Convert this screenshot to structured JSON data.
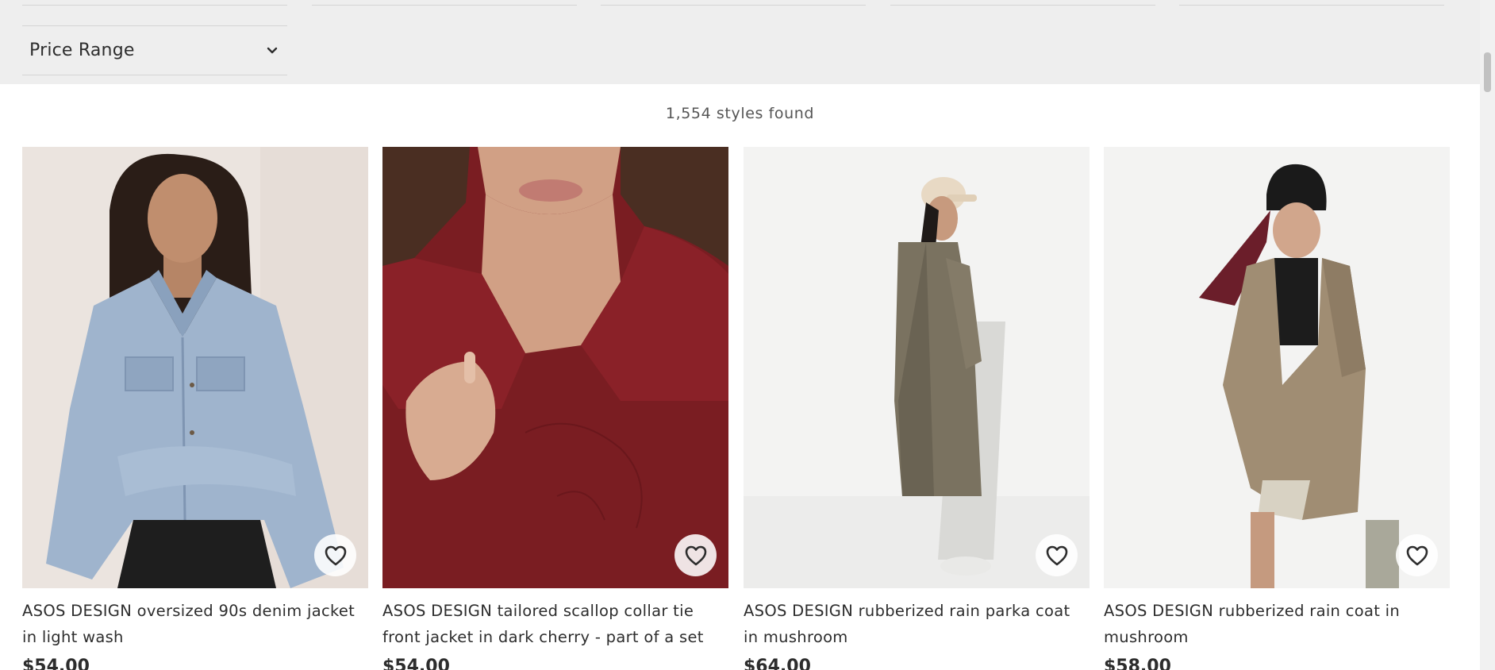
{
  "filters": {
    "price_range_label": "Price Range"
  },
  "results": {
    "count_text": "1,554 styles found"
  },
  "products": [
    {
      "title": "ASOS DESIGN oversized 90s denim jacket in light wash",
      "price": "$54.00"
    },
    {
      "title": "ASOS DESIGN tailored scallop collar tie front jacket in dark cherry - part of a set",
      "price": "$54.00"
    },
    {
      "title": "ASOS DESIGN rubberized rain parka coat in mushroom",
      "price": "$64.00"
    },
    {
      "title": "ASOS DESIGN rubberized rain coat in mushroom",
      "price": "$58.00"
    }
  ],
  "icons": {
    "chevron": "chevron-down-icon",
    "heart": "heart-outline-icon"
  },
  "colors": {
    "filter_background": "#eeeeee",
    "text": "#2d2d2d"
  }
}
